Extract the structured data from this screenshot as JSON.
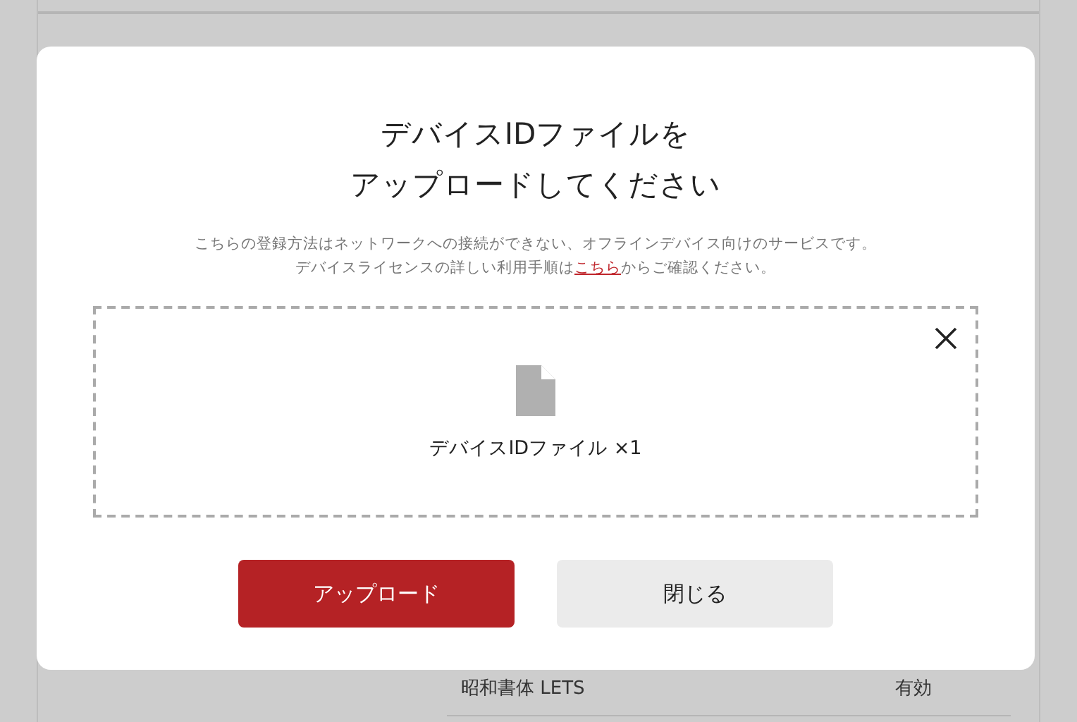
{
  "background": {
    "rows": [
      {
        "name": "昭和書体 LETS",
        "status": "有効"
      }
    ]
  },
  "dialog": {
    "title_lines": [
      "デバイスIDファイルを",
      "アップロードしてください"
    ],
    "description": {
      "line1": "こちらの登録方法はネットワークへの接続ができない、オフラインデバイス向けのサービスです。",
      "line2_before": "デバイスライセンスの詳しい利用手順は",
      "link": "こちら",
      "line2_after": "からご確認ください。"
    },
    "dropzone": {
      "file_label": "デバイスIDファイル ×1"
    },
    "buttons": [
      {
        "label": "アップロード",
        "kind": "primary"
      },
      {
        "label": "閉じる",
        "kind": "secondary"
      }
    ]
  }
}
